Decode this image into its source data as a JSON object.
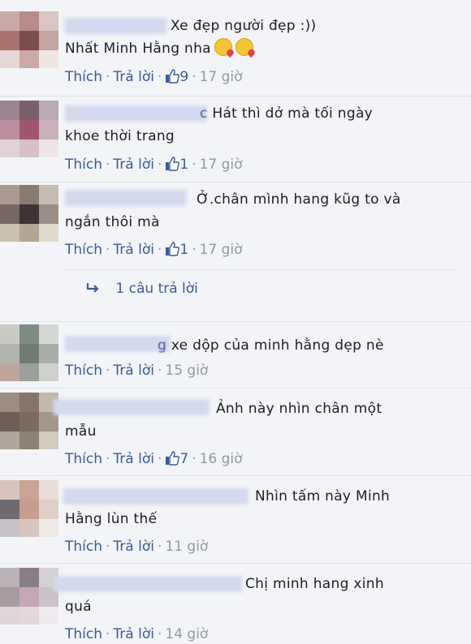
{
  "actions": {
    "like": "Thích",
    "reply": "Trả lời"
  },
  "comments": [
    {
      "lines": [
        "Xe đẹp người đẹp :))",
        "Nhất Minh Hằng nha"
      ],
      "likes": "9",
      "time": "17 giờ",
      "emoji_icon": "kiss-emoji-icon"
    },
    {
      "name_fragment": "c",
      "lines": [
        "Hát thì dở mà tối ngày",
        "khoe thời trang"
      ],
      "likes": "1",
      "time": "17 giờ"
    },
    {
      "lines": [
        "Ở.chân mình hang kũg to và",
        "ngắn thôi mà"
      ],
      "likes": "1",
      "time": "17 giờ",
      "replies_label": "1 câu trả lời"
    },
    {
      "name_fragment": "g",
      "lines": [
        "xe dộp của minh hằng dẹp nè"
      ],
      "likes": "",
      "time": "15 giờ"
    },
    {
      "lines": [
        "Ảnh này nhìn chân một",
        "mẫu"
      ],
      "likes": "7",
      "time": "16 giờ"
    },
    {
      "lines": [
        "Nhìn tấm này Minh",
        "Hằng lùn thế"
      ],
      "likes": "",
      "time": "11 giờ"
    },
    {
      "lines": [
        "Chị minh hang xinh",
        "quá"
      ],
      "likes": "",
      "time": "14 giờ"
    }
  ],
  "colors": {
    "link": "#3b5a98",
    "meta": "#9197a3",
    "text": "#1c1e21",
    "background": "#f3f4f7"
  }
}
